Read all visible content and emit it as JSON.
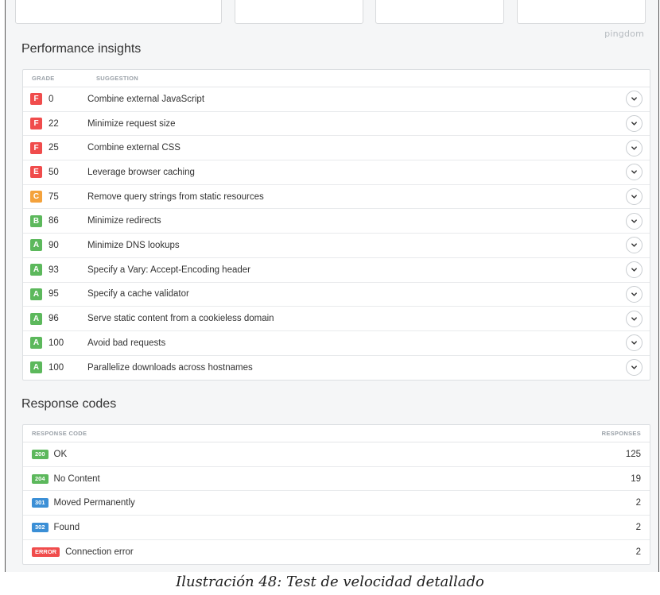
{
  "brand": "pingdom",
  "insights": {
    "title": "Performance insights",
    "col_grade": "GRADE",
    "col_suggestion": "SUGGESTION",
    "rows": [
      {
        "grade": "F",
        "score": "0",
        "suggestion": "Combine external JavaScript",
        "color": "#f04c4c"
      },
      {
        "grade": "F",
        "score": "22",
        "suggestion": "Minimize request size",
        "color": "#f04c4c"
      },
      {
        "grade": "F",
        "score": "25",
        "suggestion": "Combine external CSS",
        "color": "#f04c4c"
      },
      {
        "grade": "E",
        "score": "50",
        "suggestion": "Leverage browser caching",
        "color": "#f04c4c"
      },
      {
        "grade": "C",
        "score": "75",
        "suggestion": "Remove query strings from static resources",
        "color": "#f4a23c"
      },
      {
        "grade": "B",
        "score": "86",
        "suggestion": "Minimize redirects",
        "color": "#5cb85c"
      },
      {
        "grade": "A",
        "score": "90",
        "suggestion": "Minimize DNS lookups",
        "color": "#5cb85c"
      },
      {
        "grade": "A",
        "score": "93",
        "suggestion": "Specify a Vary: Accept-Encoding header",
        "color": "#5cb85c"
      },
      {
        "grade": "A",
        "score": "95",
        "suggestion": "Specify a cache validator",
        "color": "#5cb85c"
      },
      {
        "grade": "A",
        "score": "96",
        "suggestion": "Serve static content from a cookieless domain",
        "color": "#5cb85c"
      },
      {
        "grade": "A",
        "score": "100",
        "suggestion": "Avoid bad requests",
        "color": "#5cb85c"
      },
      {
        "grade": "A",
        "score": "100",
        "suggestion": "Parallelize downloads across hostnames",
        "color": "#5cb85c"
      }
    ]
  },
  "responses": {
    "title": "Response codes",
    "col_code": "RESPONSE CODE",
    "col_responses": "RESPONSES",
    "rows": [
      {
        "code": "200",
        "label": "OK",
        "count": "125",
        "color": "#5cb85c"
      },
      {
        "code": "204",
        "label": "No Content",
        "count": "19",
        "color": "#5cb85c"
      },
      {
        "code": "301",
        "label": "Moved Permanently",
        "count": "2",
        "color": "#3b8fd6"
      },
      {
        "code": "302",
        "label": "Found",
        "count": "2",
        "color": "#3b8fd6"
      },
      {
        "code": "ERROR",
        "label": "Connection error",
        "count": "2",
        "color": "#f04c4c"
      }
    ]
  },
  "caption": "Ilustración 48: Test de velocidad detallado"
}
